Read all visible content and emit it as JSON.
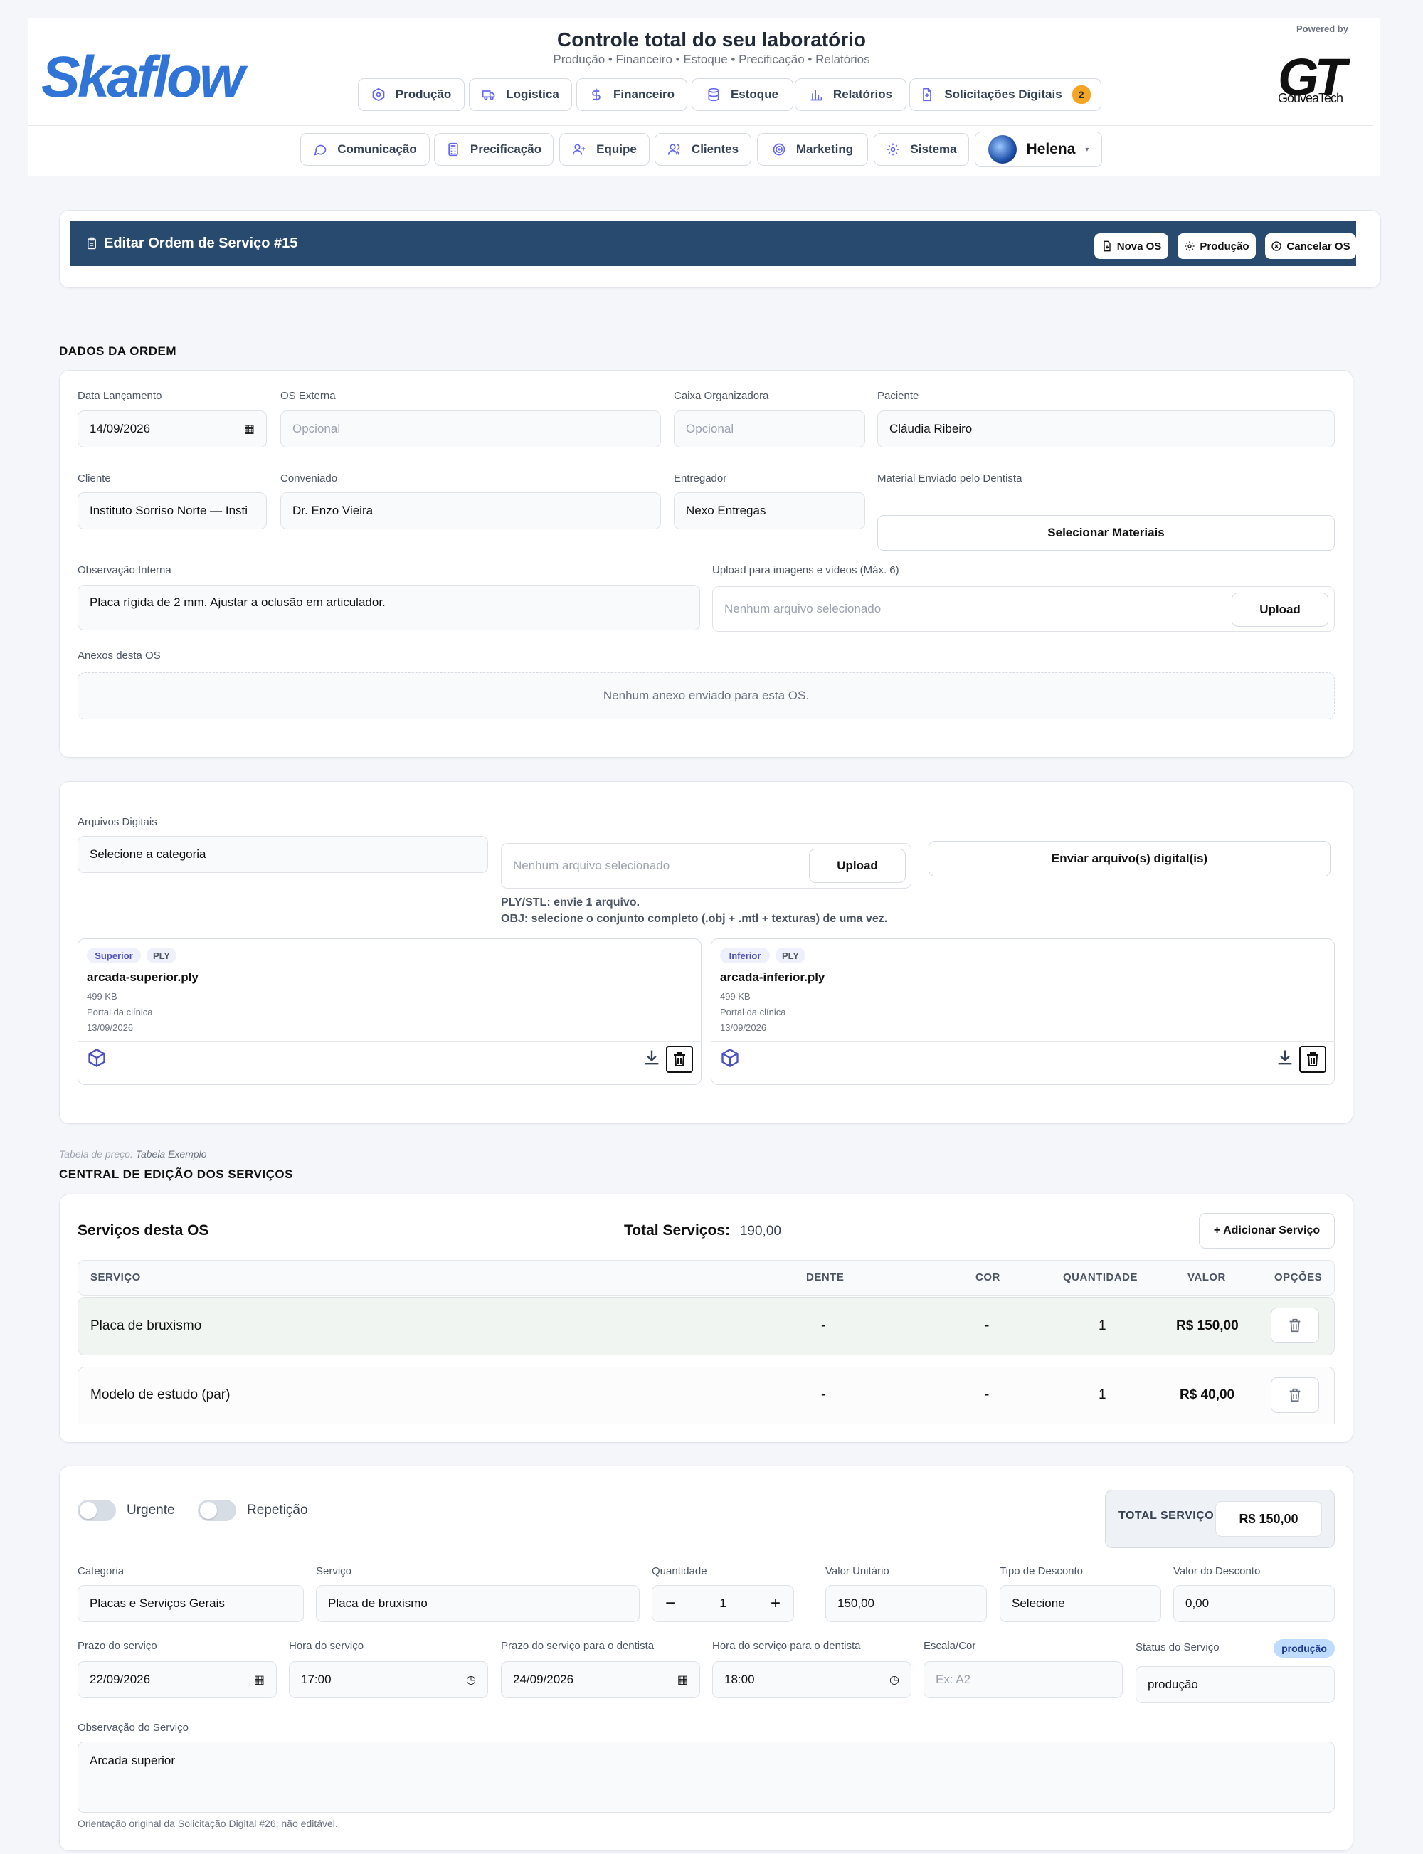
{
  "header": {
    "logo_text": "Skaflow",
    "title": "Controle total do seu laboratório",
    "subtitle": "Produção • Financeiro • Estoque • Precificação • Relatórios",
    "powered_by": "Powered by",
    "partner_logo": "GT",
    "partner_name": "GouveaTech",
    "nav_row1": [
      {
        "label": "Produção",
        "icon": "hexagon-icon"
      },
      {
        "label": "Logística",
        "icon": "truck-icon"
      },
      {
        "label": "Financeiro",
        "icon": "dollar-icon"
      },
      {
        "label": "Estoque",
        "icon": "database-icon"
      },
      {
        "label": "Relatórios",
        "icon": "chart-icon"
      },
      {
        "label": "Solicitações Digitais",
        "icon": "file-icon",
        "badge": "2"
      }
    ],
    "nav_row2": [
      {
        "label": "Comunicação",
        "icon": "chat-icon"
      },
      {
        "label": "Precificação",
        "icon": "calculator-icon"
      },
      {
        "label": "Equipe",
        "icon": "user-plus-icon"
      },
      {
        "label": "Clientes",
        "icon": "users-icon"
      },
      {
        "label": "Marketing",
        "icon": "target-icon"
      },
      {
        "label": "Sistema",
        "icon": "gear-icon"
      }
    ],
    "user_name": "Helena"
  },
  "banner": {
    "title": "Editar Ordem de Serviço #15",
    "btn_new": "Nova OS",
    "btn_production": "Produção",
    "btn_cancel": "Cancelar OS"
  },
  "order": {
    "section_title": "DADOS DA ORDEM",
    "data_lancamento_label": "Data Lançamento",
    "data_lancamento": "14/09/2026",
    "os_externa_label": "OS Externa",
    "os_externa_placeholder": "Opcional",
    "caixa_label": "Caixa Organizadora",
    "caixa_placeholder": "Opcional",
    "paciente_label": "Paciente",
    "paciente": "Cláudia Ribeiro",
    "cliente_label": "Cliente",
    "cliente": "Instituto Sorriso Norte — Insti",
    "conveniado_label": "Conveniado",
    "conveniado": "Dr. Enzo Vieira",
    "entregador_label": "Entregador",
    "entregador": "Nexo Entregas",
    "material_label": "Material Enviado pelo Dentista",
    "material_button": "Selecionar Materiais",
    "obs_label": "Observação Interna",
    "obs": "Placa rígida de 2 mm. Ajustar a oclusão em articulador.",
    "upload_label": "Upload para imagens e vídeos (Máx. 6)",
    "upload_placeholder": "Nenhum arquivo selecionado",
    "upload_button": "Upload",
    "anexos_label": "Anexos desta OS",
    "anexos_empty": "Nenhum anexo enviado para esta OS."
  },
  "digital": {
    "label": "Arquivos Digitais",
    "category_placeholder": "Selecione a categoria",
    "file_placeholder": "Nenhum arquivo selecionado",
    "upload_button": "Upload",
    "send_button": "Enviar arquivo(s) digital(is)",
    "hint1": "PLY/STL: envie 1 arquivo.",
    "hint2": "OBJ: selecione o conjunto completo (.obj + .mtl + texturas) de uma vez.",
    "files": [
      {
        "tag": "Superior",
        "type": "PLY",
        "name": "arcada-superior.ply",
        "size": "499 KB",
        "source": "Portal da clínica",
        "date": "13/09/2026"
      },
      {
        "tag": "Inferior",
        "type": "PLY",
        "name": "arcada-inferior.ply",
        "size": "499 KB",
        "source": "Portal da clínica",
        "date": "13/09/2026"
      }
    ]
  },
  "services": {
    "price_table_prefix": "Tabela de preço:",
    "price_table_name": "Tabela Exemplo",
    "section_title": "CENTRAL DE EDIÇÃO DOS SERVIÇOS",
    "card_title": "Serviços desta OS",
    "total_label": "Total Serviços:",
    "total_value": "190,00",
    "add_button": "+ Adicionar Serviço",
    "columns": [
      "SERVIÇO",
      "DENTE",
      "COR",
      "QUANTIDADE",
      "VALOR",
      "OPÇÕES"
    ],
    "rows": [
      {
        "service": "Placa de bruxismo",
        "tooth": "-",
        "color": "-",
        "qty": "1",
        "value": "R$ 150,00"
      },
      {
        "service": "Modelo de estudo (par)",
        "tooth": "-",
        "color": "-",
        "qty": "1",
        "value": "R$ 40,00"
      }
    ]
  },
  "editor": {
    "urgente": "Urgente",
    "repeticao": "Repetição",
    "total_label": "TOTAL SERVIÇO",
    "total_value": "R$ 150,00",
    "categoria_label": "Categoria",
    "categoria": "Placas e Serviços Gerais",
    "servico_label": "Serviço",
    "servico": "Placa de bruxismo",
    "quantidade_label": "Quantidade",
    "quantidade": "1",
    "valor_unitario_label": "Valor Unitário",
    "valor_unitario": "150,00",
    "tipo_desconto_label": "Tipo de Desconto",
    "tipo_desconto": "Selecione",
    "valor_desconto_label": "Valor do Desconto",
    "valor_desconto": "0,00",
    "prazo_label": "Prazo do serviço",
    "prazo": "22/09/2026",
    "hora_label": "Hora do serviço",
    "hora": "17:00",
    "prazo_dentista_label": "Prazo do serviço para o dentista",
    "prazo_dentista": "24/09/2026",
    "hora_dentista_label": "Hora do serviço para o dentista",
    "hora_dentista": "18:00",
    "escala_label": "Escala/Cor",
    "escala_placeholder": "Ex: A2",
    "status_label": "Status do Serviço",
    "status_badge": "produção",
    "status": "produção",
    "obs_label": "Observação do Serviço",
    "obs": "Arcada superior",
    "obs_hint": "Orientação original da Solicitação Digital #26; não editável."
  }
}
